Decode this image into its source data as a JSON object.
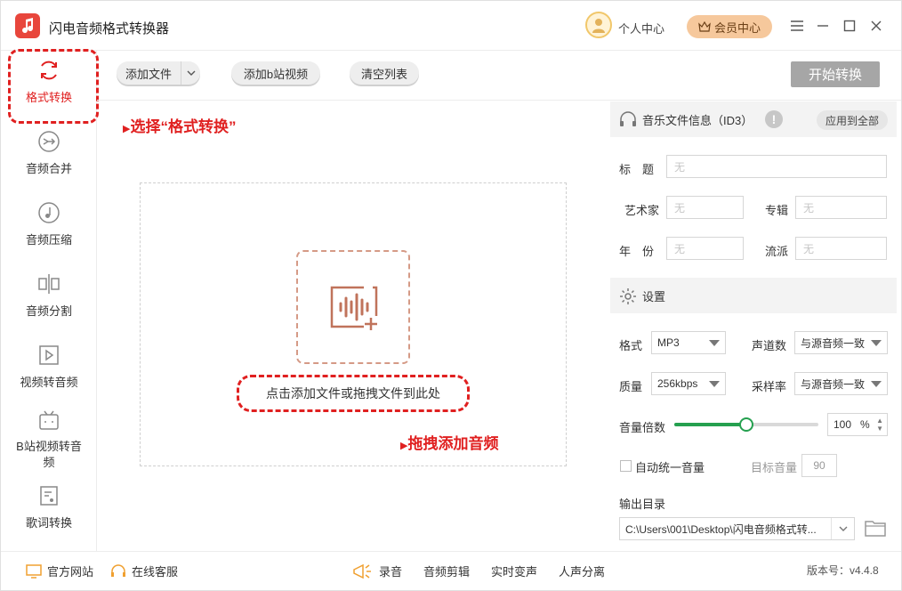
{
  "app": {
    "title": "闪电音频格式转换器",
    "personal_center": "个人中心",
    "member_center": "会员中心"
  },
  "sidebar": {
    "items": [
      {
        "label": "格式转换",
        "icon": "refresh-icon",
        "active": true
      },
      {
        "label": "音频合并",
        "icon": "merge-icon"
      },
      {
        "label": "音频压缩",
        "icon": "compress-icon"
      },
      {
        "label": "音频分割",
        "icon": "split-icon"
      },
      {
        "label": "视频转音频",
        "icon": "video-to-audio-icon"
      },
      {
        "label": "B站视频转音频",
        "icon": "bilibili-icon"
      },
      {
        "label": "歌词转换",
        "icon": "lyrics-icon"
      }
    ]
  },
  "toolbar": {
    "add_file": "添加文件",
    "add_bilibili": "添加b站视频",
    "clear_list": "清空列表",
    "start": "开始转换"
  },
  "main": {
    "annotation_select": "选择“格式转换”",
    "annotation_drag": "拖拽添加音频",
    "drop_hint": "点击添加文件或拖拽文件到此处"
  },
  "id3": {
    "title": "音乐文件信息（ID3）",
    "apply_all": "应用到全部",
    "fields": {
      "title_label": "标　题",
      "title_placeholder": "无",
      "artist_label": "艺术家",
      "artist_placeholder": "无",
      "album_label": "专辑",
      "album_placeholder": "无",
      "year_label": "年　份",
      "year_placeholder": "无",
      "genre_label": "流派",
      "genre_placeholder": "无"
    }
  },
  "settings": {
    "title": "设置",
    "format_label": "格式",
    "format_value": "MP3",
    "channel_label": "声道数",
    "channel_value": "与源音频一致",
    "quality_label": "质量",
    "quality_value": "256kbps",
    "sample_rate_label": "采样率",
    "sample_rate_value": "与源音频一致",
    "volume_label": "音量倍数",
    "volume_value": "100",
    "volume_unit": "%",
    "volume_level": 0.5,
    "normalize_label": "自动统一音量",
    "target_volume_label": "目标音量",
    "target_volume_value": "90",
    "output_dir_label": "输出目录",
    "output_dir_value": "C:\\Users\\001\\Desktop\\闪电音频格式转..."
  },
  "bottom": {
    "website": "官方网站",
    "support": "在线客服",
    "record": "录音",
    "audio_edit": "音频剪辑",
    "voice_change": "实时变声",
    "vocal_separate": "人声分离",
    "version": "版本号：v4.4.8"
  },
  "colors": {
    "accent_red": "#e02020",
    "member_bg": "#f6c89c",
    "slider_green": "#25a04f",
    "start_btn_bg": "#a6a6a6"
  }
}
